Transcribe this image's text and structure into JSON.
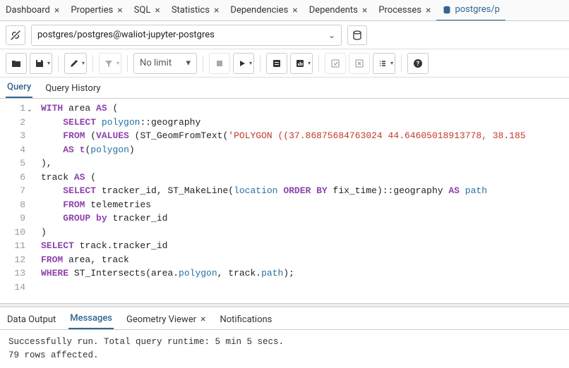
{
  "top_tabs": [
    {
      "label": "Dashboard",
      "closable": true
    },
    {
      "label": "Properties",
      "closable": true
    },
    {
      "label": "SQL",
      "closable": true
    },
    {
      "label": "Statistics",
      "closable": true
    },
    {
      "label": "Dependencies",
      "closable": true
    },
    {
      "label": "Dependents",
      "closable": true
    },
    {
      "label": "Processes",
      "closable": true
    },
    {
      "label": "postgres/p",
      "closable": false,
      "active": true,
      "icon": "database"
    }
  ],
  "connection": {
    "value": "postgres/postgres@waliot-jupyter-postgres"
  },
  "toolbar": {
    "limit_label": "No limit"
  },
  "editor_tabs": {
    "query": "Query",
    "history": "Query History"
  },
  "code": {
    "lines": [
      {
        "n": 1,
        "fold": true,
        "tokens": [
          [
            "kw",
            "WITH"
          ],
          [
            "op",
            " area "
          ],
          [
            "kw",
            "AS"
          ],
          [
            "op",
            " ("
          ]
        ]
      },
      {
        "n": 2,
        "indent": 1,
        "tokens": [
          [
            "kw",
            "SELECT"
          ],
          [
            "op",
            " "
          ],
          [
            "id",
            "polygon"
          ],
          [
            "op",
            "::geography"
          ]
        ]
      },
      {
        "n": 3,
        "indent": 1,
        "tokens": [
          [
            "kw",
            "FROM"
          ],
          [
            "op",
            " ("
          ],
          [
            "kw",
            "VALUES"
          ],
          [
            "op",
            " (ST_GeomFromText("
          ],
          [
            "str",
            "'POLYGON ((37.86875684763024 44.64605018913778, 38.185"
          ]
        ]
      },
      {
        "n": 4,
        "indent": 1,
        "tokens": [
          [
            "kw",
            "AS"
          ],
          [
            "op",
            " "
          ],
          [
            "kw",
            "t"
          ],
          [
            "op",
            "("
          ],
          [
            "id",
            "polygon"
          ],
          [
            "op",
            ")"
          ]
        ]
      },
      {
        "n": 5,
        "tokens": [
          [
            "op",
            "),"
          ]
        ]
      },
      {
        "n": 6,
        "tokens": [
          [
            "op",
            "track "
          ],
          [
            "kw",
            "AS"
          ],
          [
            "op",
            " ("
          ]
        ]
      },
      {
        "n": 7,
        "indent": 1,
        "tokens": [
          [
            "kw",
            "SELECT"
          ],
          [
            "op",
            " tracker_id, ST_MakeLine("
          ],
          [
            "id",
            "location"
          ],
          [
            "op",
            " "
          ],
          [
            "kw",
            "ORDER BY"
          ],
          [
            "op",
            " fix_time)::geography "
          ],
          [
            "kw",
            "AS"
          ],
          [
            "op",
            " "
          ],
          [
            "id",
            "path"
          ]
        ]
      },
      {
        "n": 8,
        "indent": 1,
        "tokens": [
          [
            "kw",
            "FROM"
          ],
          [
            "op",
            " telemetries"
          ]
        ]
      },
      {
        "n": 9,
        "indent": 1,
        "tokens": [
          [
            "kw",
            "GROUP by"
          ],
          [
            "op",
            " tracker_id"
          ]
        ]
      },
      {
        "n": 10,
        "tokens": [
          [
            "op",
            ")"
          ]
        ]
      },
      {
        "n": 11,
        "tokens": [
          [
            "kw",
            "SELECT"
          ],
          [
            "op",
            " track.tracker_id"
          ]
        ]
      },
      {
        "n": 12,
        "tokens": [
          [
            "kw",
            "FROM"
          ],
          [
            "op",
            " area, track"
          ]
        ]
      },
      {
        "n": 13,
        "tokens": [
          [
            "kw",
            "WHERE"
          ],
          [
            "op",
            " ST_Intersects(area."
          ],
          [
            "id",
            "polygon"
          ],
          [
            "op",
            ", track."
          ],
          [
            "id",
            "path"
          ],
          [
            "op",
            ");"
          ]
        ]
      },
      {
        "n": 14,
        "tokens": []
      }
    ]
  },
  "output_tabs": {
    "data": "Data Output",
    "messages": "Messages",
    "geometry": "Geometry Viewer",
    "notifications": "Notifications"
  },
  "messages": {
    "line1": "Successfully run. Total query runtime: 5 min 5 secs.",
    "line2": "79 rows affected."
  }
}
